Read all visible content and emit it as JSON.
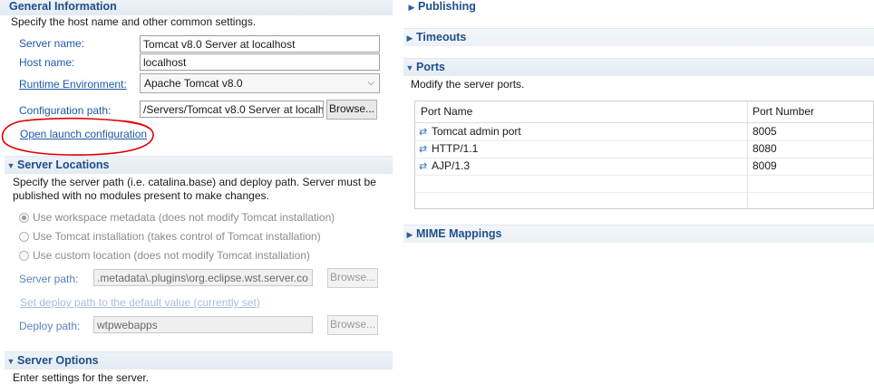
{
  "general": {
    "title": "General Information",
    "desc": "Specify the host name and other common settings.",
    "server_name_label": "Server name:",
    "server_name_value": "Tomcat v8.0 Server at localhost",
    "host_name_label": "Host name:",
    "host_name_value": "localhost",
    "runtime_label": "Runtime Environment:",
    "runtime_value": "Apache Tomcat v8.0",
    "config_path_label": "Configuration path:",
    "config_path_value": "/Servers/Tomcat v8.0 Server at localh",
    "browse_label": "Browse...",
    "open_launch_label": "Open launch configuration"
  },
  "locations": {
    "title": "Server Locations",
    "desc_line1": "Specify the server path (i.e. catalina.base) and deploy path. Server must be",
    "desc_line2": "published with no modules present to make changes.",
    "radio_workspace": "Use workspace metadata (does not modify Tomcat installation)",
    "radio_tomcat": "Use Tomcat installation (takes control of Tomcat installation)",
    "radio_custom": "Use custom location (does not modify Tomcat installation)",
    "server_path_label": "Server path:",
    "server_path_value": ".metadata\\.plugins\\org.eclipse.wst.server.co",
    "server_path_browse": "Browse...",
    "set_deploy_label": "Set deploy path to the default value (currently set)",
    "deploy_path_label": "Deploy path:",
    "deploy_path_value": "wtpwebapps",
    "deploy_path_browse": "Browse..."
  },
  "options": {
    "title": "Server Options",
    "desc": "Enter settings for the server."
  },
  "right": {
    "publishing_title": "Publishing",
    "timeouts_title": "Timeouts",
    "ports_title": "Ports",
    "ports_desc": "Modify the server ports.",
    "col_port_name": "Port Name",
    "col_port_number": "Port Number",
    "ports": [
      {
        "name": "Tomcat admin port",
        "number": "8005"
      },
      {
        "name": "HTTP/1.1",
        "number": "8080"
      },
      {
        "name": "AJP/1.3",
        "number": "8009"
      }
    ],
    "mime_title": "MIME Mappings"
  },
  "colors": {
    "section_title": "#1f4f8a",
    "link": "#1d5aa7",
    "annotation_circle": "#e00000"
  },
  "icons": {
    "expanded": "triangle-down-icon",
    "collapsed": "triangle-right-icon",
    "port": "port-icon",
    "combo": "chevron-down-icon"
  }
}
